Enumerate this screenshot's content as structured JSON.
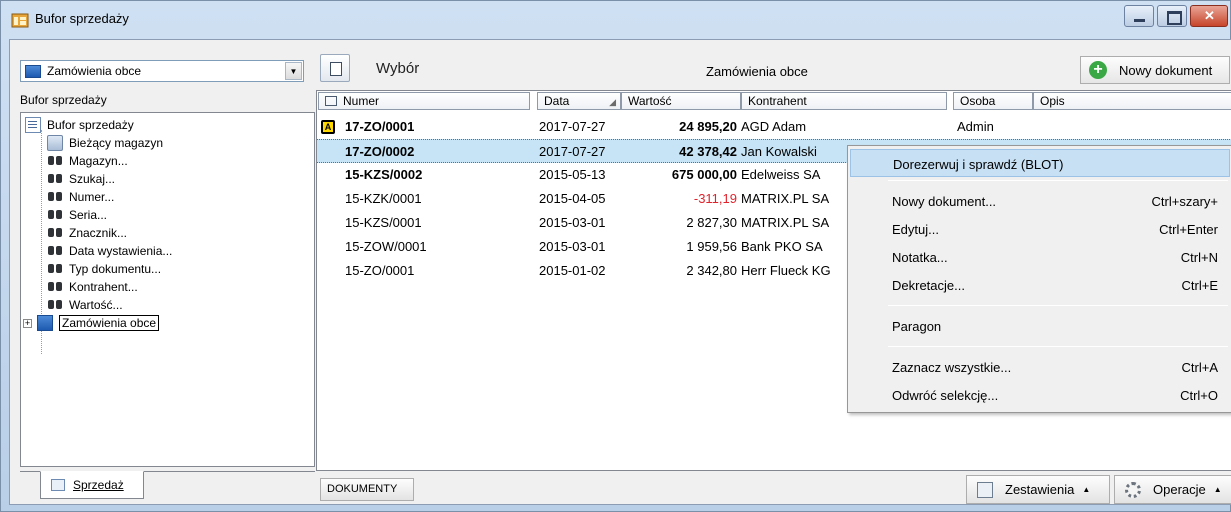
{
  "window": {
    "title": "Bufor sprzedaży"
  },
  "left": {
    "combo_value": "Zamówienia obce",
    "caption": "Bufor sprzedaży",
    "tree": {
      "root": "Bufor sprzedaży",
      "items": [
        "Bieżący magazyn",
        "Magazyn...",
        "Szukaj...",
        "Numer...",
        "Seria...",
        "Znacznik...",
        "Data wystawienia...",
        "Typ dokumentu...",
        "Kontrahent...",
        "Wartość..."
      ],
      "expandable": "Zamówienia obce",
      "expander": "+"
    },
    "tab_label": "Sprzedaż"
  },
  "toolbar": {
    "wybor": "Wybór",
    "title": "Zamówienia obce",
    "new_doc": "Nowy dokument",
    "new_doc_glyph": "+"
  },
  "grid": {
    "headers": {
      "numer": "Numer",
      "data": "Data",
      "wartosc": "Wartość",
      "kontrahent": "Kontrahent",
      "osoba": "Osoba",
      "opis": "Opis"
    },
    "rows": [
      {
        "numer": "17-ZO/0001",
        "data": "2017-07-27",
        "wartosc": "24 895,20",
        "kontrahent": "AGD Adam",
        "osoba": "Admin",
        "bold": true,
        "locked": true,
        "lock_glyph": "A"
      },
      {
        "numer": "17-ZO/0002",
        "data": "2017-07-27",
        "wartosc": "42 378,42",
        "kontrahent": "Jan Kowalski",
        "osoba": "",
        "bold": true,
        "selected": true
      },
      {
        "numer": "15-KZS/0002",
        "data": "2015-05-13",
        "wartosc": "675 000,00",
        "kontrahent": "Edelweiss SA",
        "osoba": "",
        "bold": true
      },
      {
        "numer": "15-KZK/0001",
        "data": "2015-04-05",
        "wartosc": "-311,19",
        "kontrahent": "MATRIX.PL SA",
        "osoba": "",
        "negative": true
      },
      {
        "numer": "15-KZS/0001",
        "data": "2015-03-01",
        "wartosc": "2 827,30",
        "kontrahent": "MATRIX.PL SA",
        "osoba": ""
      },
      {
        "numer": "15-ZOW/0001",
        "data": "2015-03-01",
        "wartosc": "1 959,56",
        "kontrahent": "Bank PKO SA",
        "osoba": ""
      },
      {
        "numer": "15-ZO/0001",
        "data": "2015-01-02",
        "wartosc": "2 342,80",
        "kontrahent": "Herr Flueck KG",
        "osoba": ""
      }
    ]
  },
  "bottom": {
    "dokumenty": "DOKUMENTY",
    "zestawienia": "Zestawienia",
    "operacje": "Operacje",
    "caret": "▲"
  },
  "context_menu": {
    "items": [
      {
        "label": "Dorezerwuj i sprawdź (BLOT)",
        "shortcut": ""
      },
      {
        "label": "Nowy dokument...",
        "shortcut": "Ctrl+szary+"
      },
      {
        "label": "Edytuj...",
        "shortcut": "Ctrl+Enter"
      },
      {
        "label": "Notatka...",
        "shortcut": "Ctrl+N"
      },
      {
        "label": "Dekretacje...",
        "shortcut": "Ctrl+E"
      },
      {
        "label": "Paragon",
        "shortcut": ""
      },
      {
        "label": "Zaznacz wszystkie...",
        "shortcut": "Ctrl+A"
      },
      {
        "label": "Odwróć selekcję...",
        "shortcut": "Ctrl+O"
      }
    ]
  },
  "colors": {
    "selection": "#c6e4f5",
    "negative": "#e0232c",
    "menu_highlight": "#c7e0f4"
  }
}
